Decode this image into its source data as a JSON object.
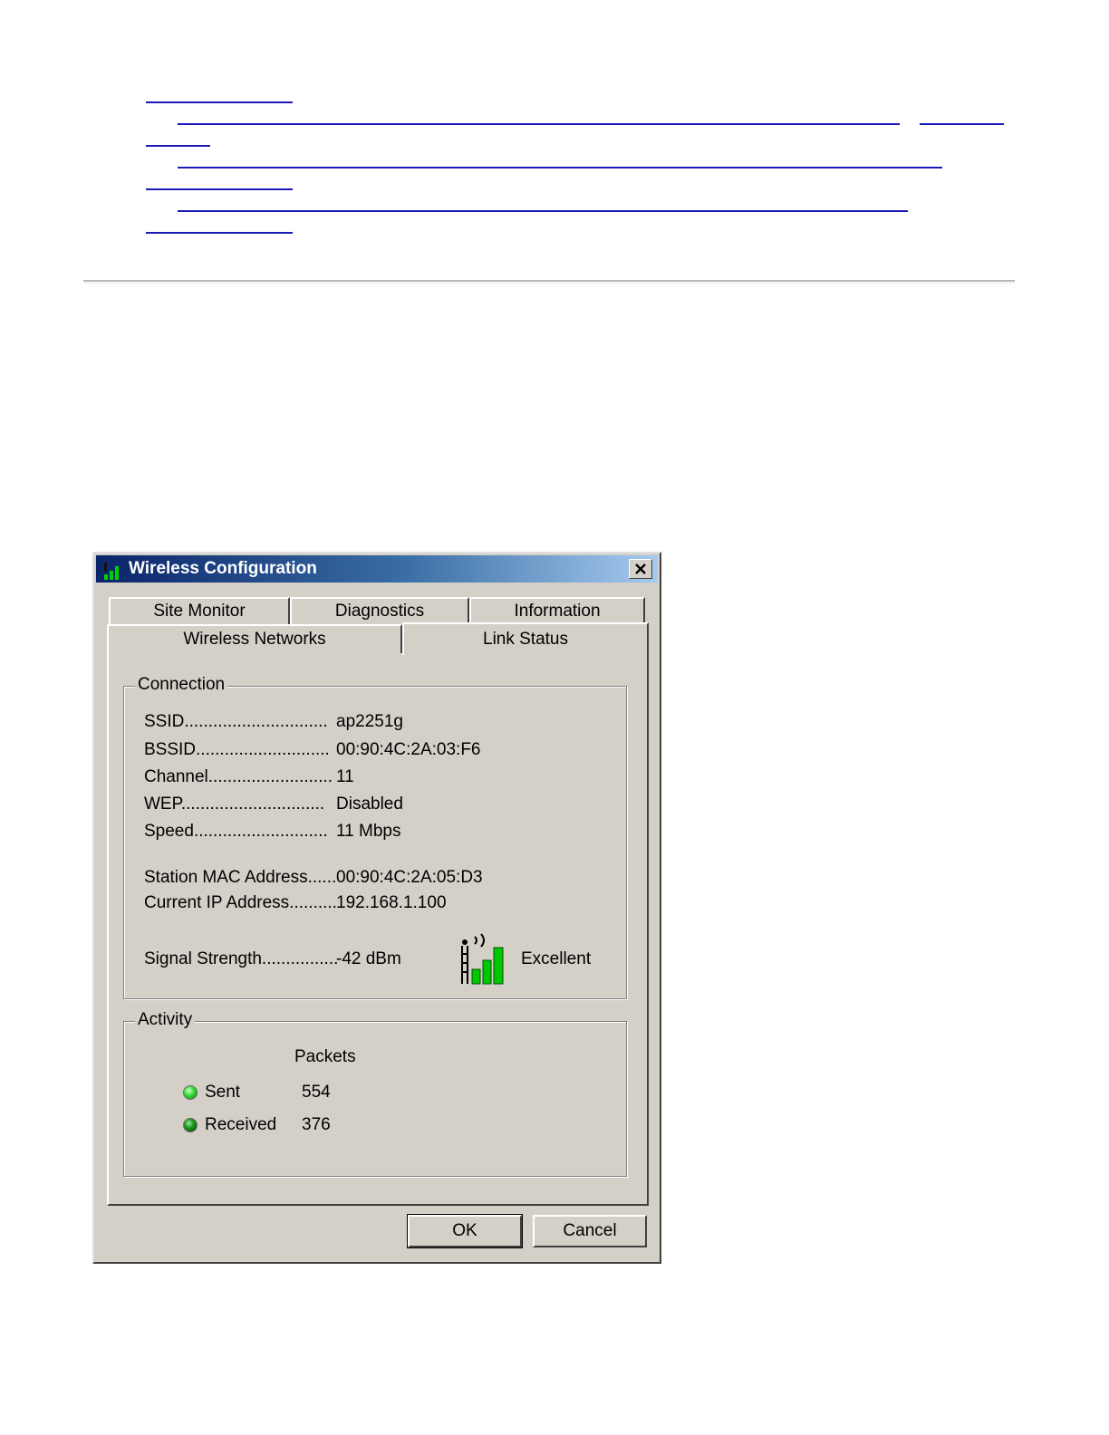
{
  "dialog": {
    "title": "Wireless Configuration",
    "tabs_row1": [
      "Site Monitor",
      "Diagnostics",
      "Information"
    ],
    "tabs_row2": [
      "Wireless Networks",
      "Link Status"
    ],
    "active_tab": "Link Status",
    "connection": {
      "group_label": "Connection",
      "ssid_label": "SSID..............................",
      "ssid_value": "ap2251g",
      "bssid_label": "BSSID............................",
      "bssid_value": "00:90:4C:2A:03:F6",
      "channel_label": "Channel..........................",
      "channel_value": "11",
      "wep_label": "WEP..............................",
      "wep_value": "Disabled",
      "speed_label": "Speed............................",
      "speed_value": "11 Mbps",
      "mac_label": "Station MAC Address......",
      "mac_value": "00:90:4C:2A:05:D3",
      "ip_label": "Current IP Address..........",
      "ip_value": "192.168.1.100",
      "signal_label": "Signal Strength................",
      "signal_value": "-42 dBm",
      "signal_quality": "Excellent",
      "signal_icon": "signal-strength-icon"
    },
    "activity": {
      "group_label": "Activity",
      "packets_header": "Packets",
      "sent_label": "Sent",
      "sent_value": "554",
      "received_label": "Received",
      "received_value": "376"
    },
    "buttons": {
      "ok": "OK",
      "cancel": "Cancel"
    },
    "close_icon": "close-icon",
    "colors": {
      "titlebar_start": "#0a246a",
      "titlebar_end": "#a6caf0",
      "face": "#d4d0c8",
      "signal_green": "#00c800",
      "link": "#1a1ab8"
    }
  }
}
